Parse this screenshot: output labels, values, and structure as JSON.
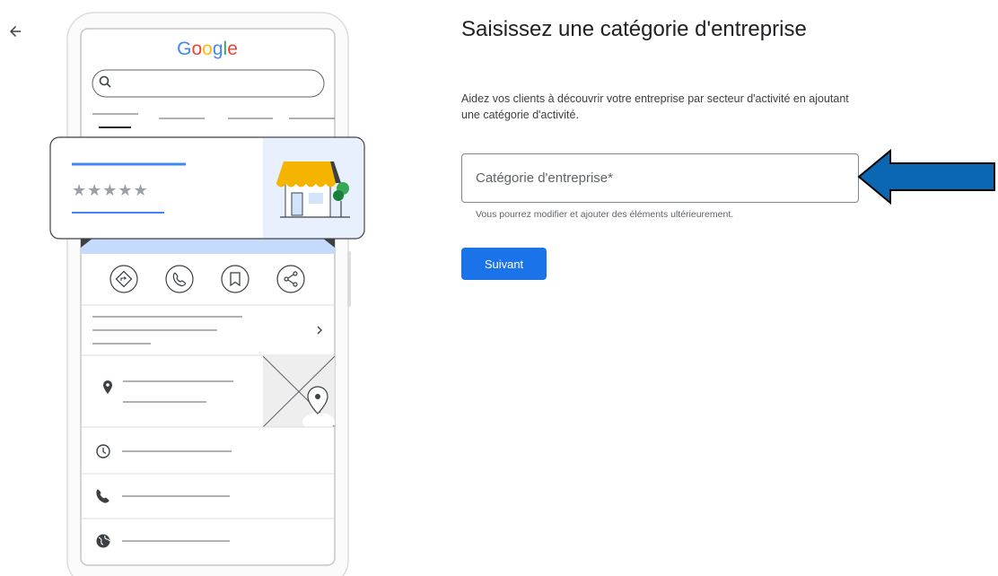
{
  "header": {
    "back_icon": "arrow-left-icon"
  },
  "illustration": {
    "logo_text": "Google",
    "rating_glyphs": "★★★★★",
    "colors": {
      "google_blue": "#4285F4",
      "google_red": "#EA4335",
      "google_yellow": "#FBBC05",
      "google_green": "#34A853",
      "awning": "#F4B400"
    },
    "icons": [
      "search-icon",
      "directions-icon",
      "phone-icon",
      "bookmark-icon",
      "share-icon",
      "chevron-right-icon",
      "location-pin-icon",
      "clock-icon",
      "phone-icon",
      "globe-icon",
      "storefront-icon",
      "map-icon"
    ]
  },
  "form": {
    "title": "Saisissez une catégorie d'entreprise",
    "description": "Aidez vos clients à découvrir votre entreprise par secteur d'activité en ajoutant une catégorie d'activité.",
    "category_input": {
      "placeholder": "Catégorie d'entreprise*",
      "value": ""
    },
    "helper": "Vous pourrez modifier et ajouter des éléments ultérieurement.",
    "next_label": "Suivant"
  },
  "colors": {
    "primary": "#1a73e8",
    "arrow_fill": "#0B67B2",
    "arrow_stroke": "#000000"
  }
}
